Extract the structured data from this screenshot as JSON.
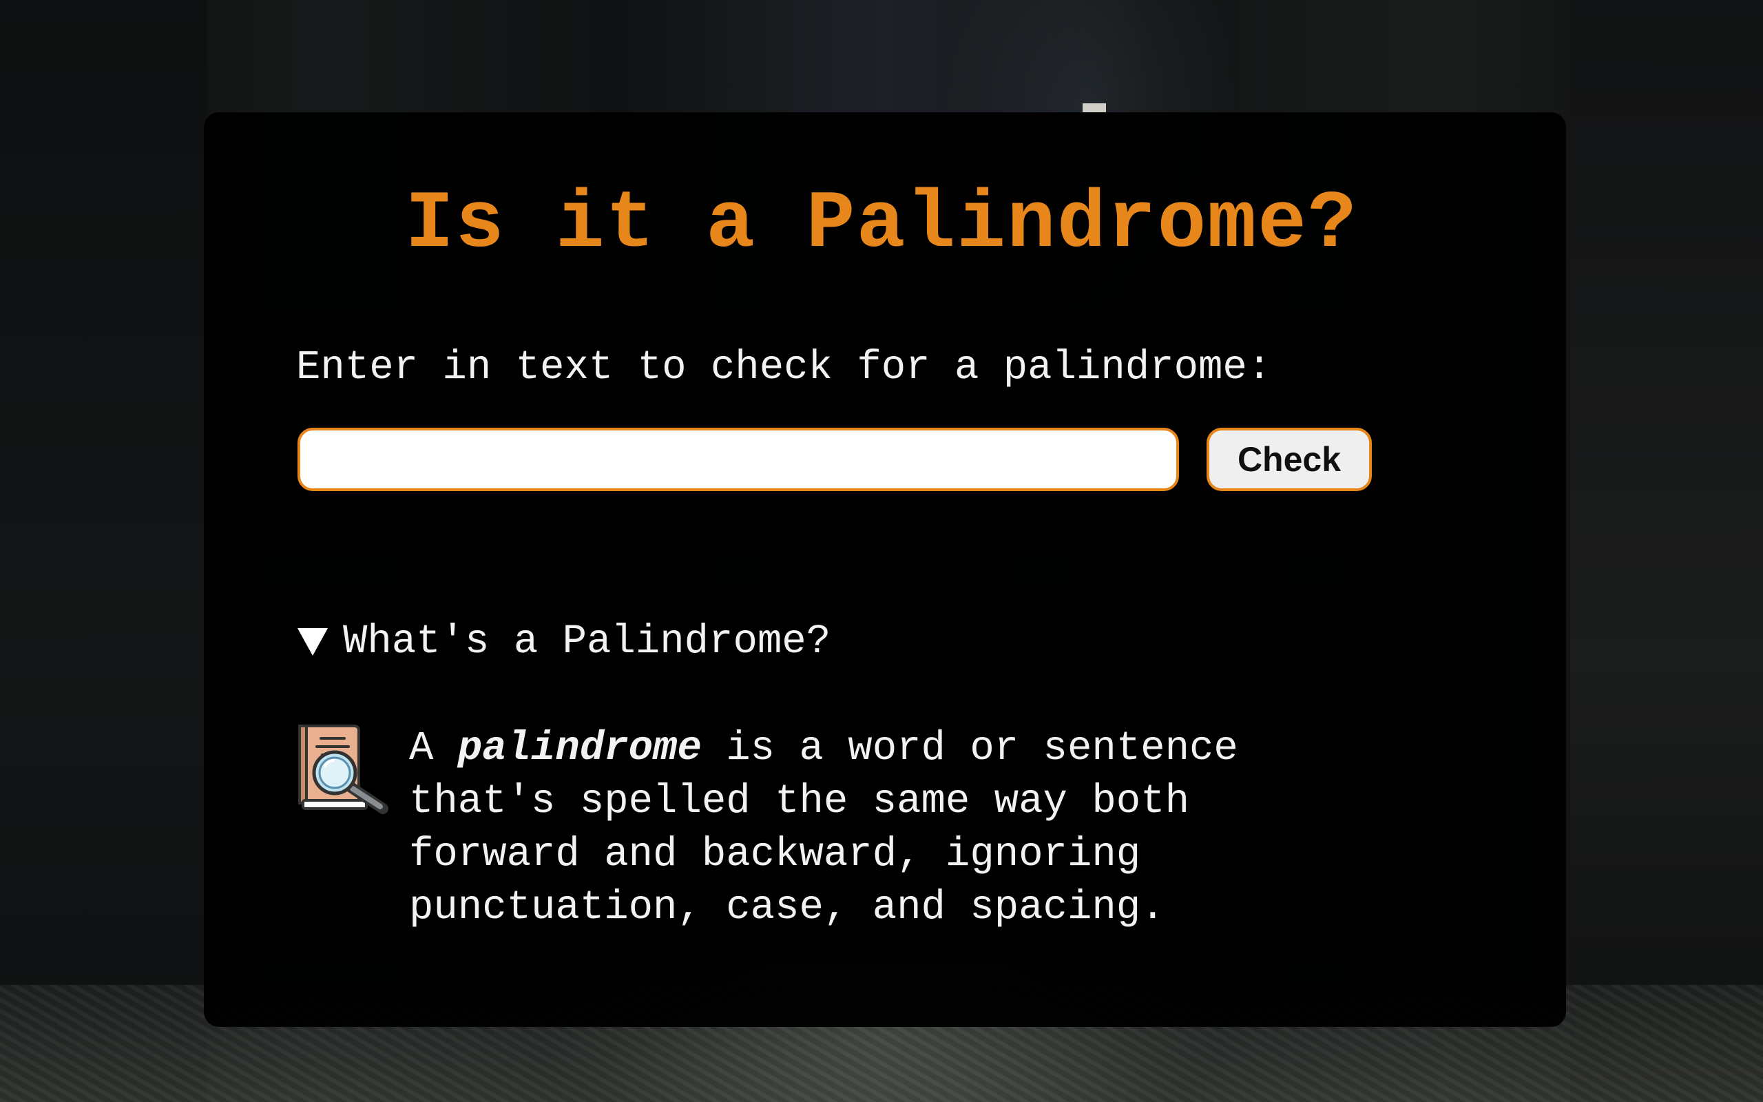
{
  "page": {
    "title": "Is it a Palindrome?"
  },
  "checker": {
    "prompt_label": "Enter in text to check for a palindrome:",
    "input_value": "",
    "input_placeholder": "",
    "check_button_label": "Check"
  },
  "info": {
    "summary_label": "What's a Palindrome?",
    "expanded": true,
    "definition_lead": "A ",
    "definition_term": "palindrome",
    "definition_line1_rest": " is a word or sentence",
    "definition_rest": "that's spelled the same way both\nforward and backward, ignoring\npunctuation, case, and spacing.",
    "icon": "book-magnifier-icon"
  },
  "colors": {
    "accent": "#e6861b",
    "panel": "#000000",
    "text": "#f2f2f2"
  }
}
